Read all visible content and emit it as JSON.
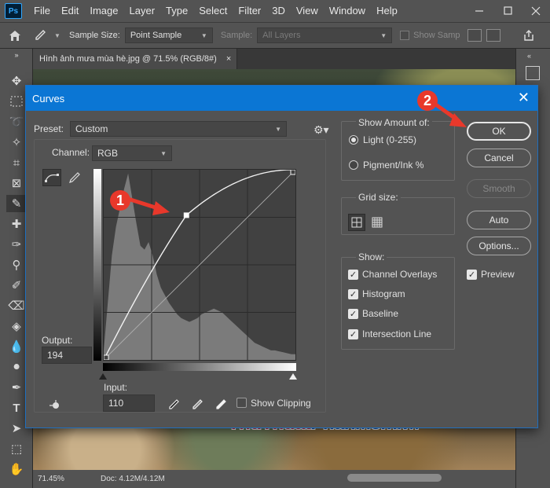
{
  "menubar": {
    "items": [
      "File",
      "Edit",
      "Image",
      "Layer",
      "Type",
      "Select",
      "Filter",
      "3D",
      "View",
      "Window",
      "Help"
    ]
  },
  "options_bar": {
    "sample_size_label": "Sample Size:",
    "sample_size_value": "Point Sample",
    "sample_label": "Sample:",
    "sample_value": "All Layers",
    "show_sampling_label": "Show Samp"
  },
  "document": {
    "tab_title": "Hình ảnh mưa mùa hè.jpg @ 71.5% (RGB/8#)",
    "tab_close": "×",
    "zoom": "71.45%",
    "doc_info": "Doc: 4.12M/4.12M"
  },
  "curves_dialog": {
    "title": "Curves",
    "close": "✕",
    "preset_label": "Preset:",
    "preset_value": "Custom",
    "channel_label": "Channel:",
    "channel_value": "RGB",
    "output_label": "Output:",
    "output_value": "194",
    "input_label": "Input:",
    "input_value": "110",
    "show_clipping_label": "Show Clipping",
    "show_amount": {
      "title": "Show Amount of:",
      "light_label": "Light  (0-255)",
      "pigment_label": "Pigment/Ink %",
      "selected": "light"
    },
    "grid_size": {
      "title": "Grid size:"
    },
    "show": {
      "title": "Show:",
      "channel_overlays": "Channel Overlays",
      "histogram": "Histogram",
      "baseline": "Baseline",
      "intersection_line": "Intersection Line"
    },
    "buttons": {
      "ok": "OK",
      "cancel": "Cancel",
      "smooth": "Smooth",
      "auto": "Auto",
      "options": "Options...",
      "preview": "Preview"
    },
    "curve_points": [
      {
        "input": 0,
        "output": 0
      },
      {
        "input": 110,
        "output": 194
      },
      {
        "input": 255,
        "output": 255
      }
    ]
  },
  "annotations": {
    "marker1": "1",
    "marker2": "2"
  },
  "watermark": {
    "part1": "Thu",
    "part2": "Thuat",
    "part3": "Phan",
    "part4": "Mem",
    "part5": ".vn"
  },
  "colors": {
    "accent": "#0b76d4",
    "marker": "#e8382b"
  }
}
